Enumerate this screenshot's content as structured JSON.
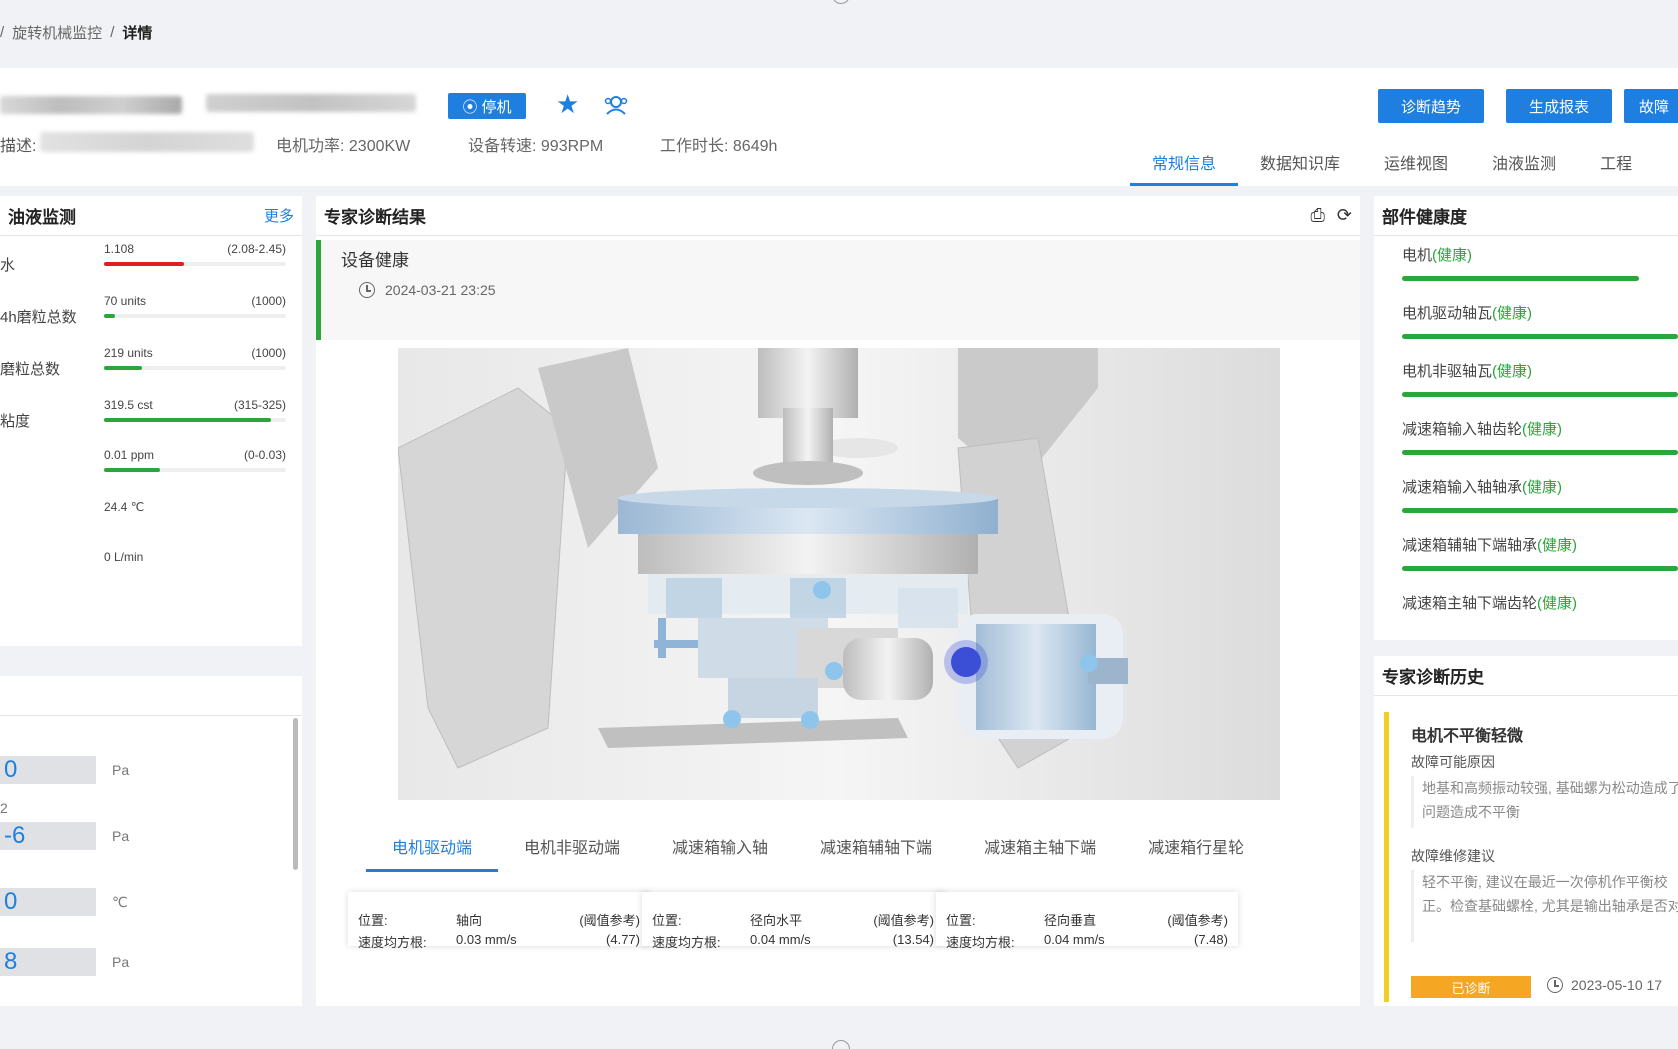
{
  "breadcrumb": {
    "sep": "/",
    "parent": "旋转机械监控",
    "current": "详情"
  },
  "header": {
    "status_label": "停机",
    "desc_label": "描述:",
    "specs": [
      "电机功率: 2300KW",
      "设备转速: 993RPM",
      "工作时长: 8649h"
    ],
    "buttons": [
      "诊断趋势",
      "生成报表",
      "故障"
    ],
    "tabs": [
      "常规信息",
      "数据知识库",
      "运维视图",
      "油液监测",
      "工程"
    ]
  },
  "oil_panel": {
    "title": "油液监测",
    "more": "更多",
    "metrics": [
      {
        "name": "水",
        "value": "1.108",
        "range": "(2.08-2.45)",
        "fraction": 0.44,
        "color": "#e02020"
      },
      {
        "name": "4h磨粒总数",
        "value": "70 units",
        "range": "(1000)",
        "fraction": 0.06,
        "color": "#2aa63a"
      },
      {
        "name": "磨粒总数",
        "value": "219 units",
        "range": "(1000)",
        "fraction": 0.21,
        "color": "#2aa63a"
      },
      {
        "name": "粘度",
        "value": "319.5 cst",
        "range": "(315-325)",
        "fraction": 0.92,
        "color": "#2aa63a"
      },
      {
        "name": "",
        "value": "0.01 ppm",
        "range": "(0-0.03)",
        "fraction": 0.31,
        "color": "#2aa63a"
      },
      {
        "name": "",
        "value": "24.4 ℃",
        "range": "",
        "fraction": null,
        "color": ""
      },
      {
        "name": "",
        "value": "0 L/min",
        "range": "",
        "fraction": null,
        "color": ""
      }
    ]
  },
  "sensor_panel": {
    "title": "",
    "rows": [
      {
        "label": "",
        "value": "0",
        "unit": "Pa"
      },
      {
        "label": "2",
        "value": "-6",
        "unit": "Pa"
      },
      {
        "label": "",
        "value": "0",
        "unit": "℃"
      },
      {
        "label": "",
        "value": "8",
        "unit": "Pa"
      }
    ]
  },
  "diagnosis": {
    "title": "专家诊断结果",
    "result": "设备健康",
    "time": "2024-03-21 23:25",
    "tabs": [
      "电机驱动端",
      "电机非驱动端",
      "减速箱输入轴",
      "减速箱辅轴下端",
      "减速箱主轴下端",
      "减速箱行星轮"
    ],
    "cards": [
      {
        "pos_label": "位置:",
        "pos": "轴向",
        "ref": "(阈值参考)",
        "vel_label": "速度均方根:",
        "vel": "0.03 mm/s",
        "vel_ref": "(4.77)"
      },
      {
        "pos_label": "位置:",
        "pos": "径向水平",
        "ref": "(阈值参考)",
        "vel_label": "速度均方根:",
        "vel": "0.04 mm/s",
        "vel_ref": "(13.54)"
      },
      {
        "pos_label": "位置:",
        "pos": "径向垂直",
        "ref": "(阈值参考)",
        "vel_label": "速度均方根:",
        "vel": "0.04 mm/s",
        "vel_ref": "(7.48)"
      }
    ]
  },
  "parts_panel": {
    "title": "部件健康度",
    "items": [
      {
        "name": "电机",
        "status": "(健康)",
        "fraction": 0.86
      },
      {
        "name": "电机驱动轴瓦",
        "status": "(健康)",
        "fraction": 1.0
      },
      {
        "name": "电机非驱轴瓦",
        "status": "(健康)",
        "fraction": 1.0
      },
      {
        "name": "减速箱输入轴齿轮",
        "status": "(健康)",
        "fraction": 1.0
      },
      {
        "name": "减速箱输入轴轴承",
        "status": "(健康)",
        "fraction": 1.0
      },
      {
        "name": "减速箱辅轴下端轴承",
        "status": "(健康)",
        "fraction": 1.0
      },
      {
        "name": "减速箱主轴下端齿轮",
        "status": "(健康)",
        "fraction": null
      }
    ]
  },
  "history_panel": {
    "title": "专家诊断历史",
    "entry_title": "电机不平衡轻微",
    "cause_label": "故障可能原因",
    "cause_text": "地基和高频振动较强, 基础螺为松动造成了问题造成不平衡",
    "advice_label": "故障维修建议",
    "advice_text": "轻不平衡, 建议在最近一次停机作平衡校正。检查基础螺栓, 尤其是输出轴承是否对",
    "tag": "已诊断",
    "time": "2023-05-10 17"
  },
  "colors": {
    "accent": "#1e7fe0",
    "healthy": "#2aa63a",
    "alarm": "#e02020",
    "history_border": "#f0cf1e",
    "tag": "#f5a623"
  }
}
